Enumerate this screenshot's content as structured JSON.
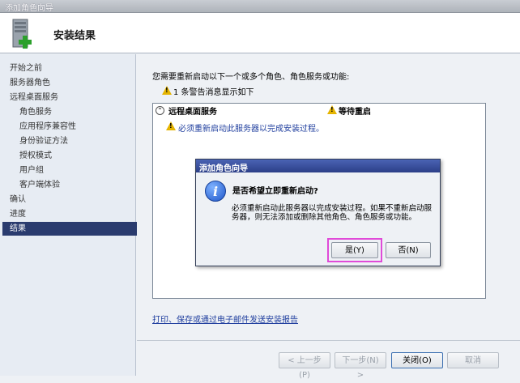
{
  "window": {
    "title": "添加角色向导"
  },
  "header": {
    "title": "安装结果",
    "icon": "server-install-icon"
  },
  "nav": {
    "items": [
      {
        "label": "开始之前",
        "level": 0,
        "active": false
      },
      {
        "label": "服务器角色",
        "level": 0,
        "active": false
      },
      {
        "label": "远程桌面服务",
        "level": 0,
        "active": false
      },
      {
        "label": "角色服务",
        "level": 1,
        "active": false
      },
      {
        "label": "应用程序兼容性",
        "level": 1,
        "active": false
      },
      {
        "label": "身份验证方法",
        "level": 1,
        "active": false
      },
      {
        "label": "授权模式",
        "level": 1,
        "active": false
      },
      {
        "label": "用户组",
        "level": 1,
        "active": false
      },
      {
        "label": "客户端体验",
        "level": 1,
        "active": false
      },
      {
        "label": "确认",
        "level": 0,
        "active": false
      },
      {
        "label": "进度",
        "level": 0,
        "active": false
      },
      {
        "label": "结果",
        "level": 0,
        "active": true
      }
    ]
  },
  "main": {
    "intro": "您需要重新启动以下一个或多个角色、角色服务或功能:",
    "warning_summary": "1 条警告消息显示如下",
    "results": {
      "role": "远程桌面服务",
      "status": "等待重启",
      "message": "必须重新启动此服务器以完成安装过程。"
    },
    "report_link": "打印、保存或通过电子邮件发送安装报告"
  },
  "footer": {
    "prev": "< 上一步(P)",
    "next": "下一步(N) >",
    "close": "关闭(O)",
    "cancel": "取消"
  },
  "dialog": {
    "title": "添加角色向导",
    "question": "是否希望立即重新启动?",
    "body": "必须重新启动此服务器以完成安装过程。如果不重新启动服务器，则无法添加或删除其他角色、角色服务或功能。",
    "yes": "是(Y)",
    "no": "否(N)"
  },
  "colors": {
    "accent": "#2a3b6e",
    "link": "#1f3e9e",
    "highlight": "#e04ad8",
    "warning": "#e5b400"
  }
}
